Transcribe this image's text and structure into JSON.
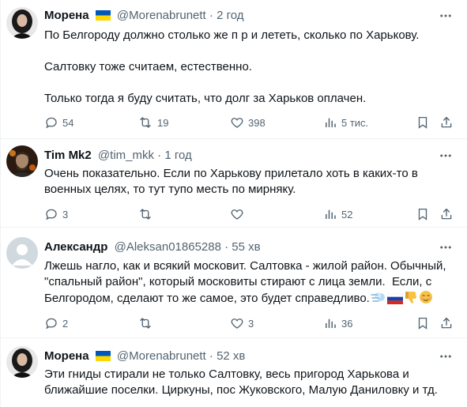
{
  "tweets": [
    {
      "name": "Морена",
      "handle": "@Morenabrunett",
      "separator": "·",
      "time": "2 год",
      "lines": [
        "По Белгороду должно столько же п р и лететь, сколько по Харькову.",
        "",
        "Салтовку тоже считаем, естественно.",
        "",
        "Только тогда я буду считать, что долг за Харьков оплачен."
      ],
      "replies": "54",
      "retweets": "19",
      "likes": "398",
      "views": "5 тис."
    },
    {
      "name": "Tim Mk2",
      "handle": "@tim_mkk",
      "separator": "·",
      "time": "1 год",
      "lines": [
        "Очень показательно. Если по Харькову прилетало хоть в каких-то в",
        "военных целях, то тут тупо месть по мирняку."
      ],
      "replies": "3",
      "retweets": "",
      "likes": "",
      "views": "52"
    },
    {
      "name": "Александр",
      "handle": "@Aleksan01865288",
      "separator": "·",
      "time": "55 хв",
      "lines": [
        "Лжешь нагло, как и всякий московит. Салтовка - жилой район. Обычный,",
        "\"спальный район\", который московиты стирают с лица земли.  Если, с",
        "Белгородом, сделают то же самое, это будет справедливо."
      ],
      "emojis": [
        "dash-icon",
        "russia-flag-icon",
        "thumbs-down-icon",
        "smiling-face-icon"
      ],
      "replies": "2",
      "retweets": "",
      "likes": "3",
      "views": "36"
    },
    {
      "name": "Морена",
      "handle": "@Morenabrunett",
      "separator": "·",
      "time": "52 хв",
      "lines": [
        "Эти гниды стирали не только Салтовку, весь пригород Харькова и",
        "ближайшие поселки. Циркуны, пос Жуковского, Малую Даниловку и тд."
      ]
    }
  ],
  "icons": {
    "flag": "ukraine-flag-icon",
    "more": "more-icon",
    "reply": "reply-icon",
    "retweet": "retweet-icon",
    "like": "like-icon",
    "views": "views-icon",
    "bookmark": "bookmark-icon",
    "share": "share-icon"
  },
  "colors": {
    "text": "#0f1419",
    "secondary": "#536471",
    "divider": "#eff3f4",
    "flag_blue": "#0057b7",
    "flag_yellow": "#ffd700"
  }
}
